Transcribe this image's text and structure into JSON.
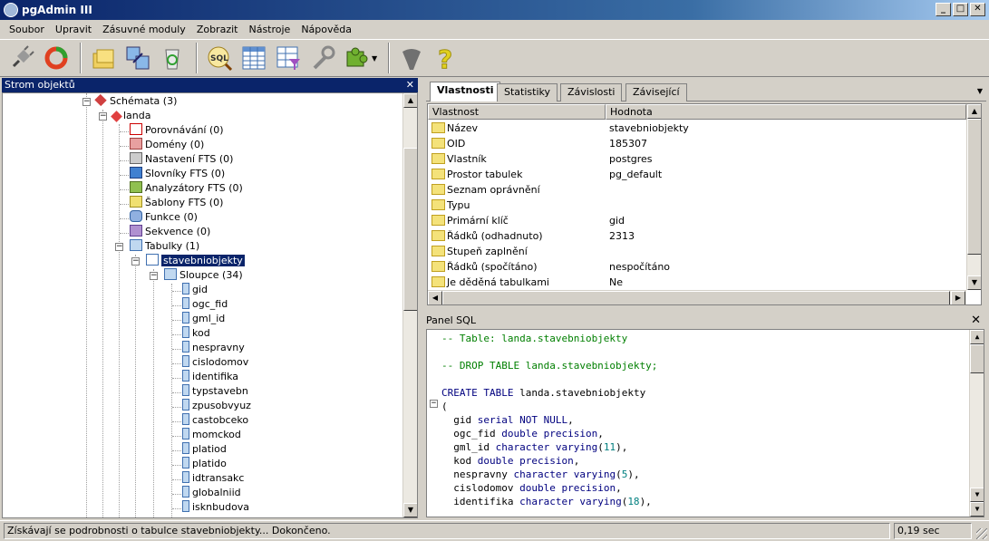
{
  "window": {
    "title": "pgAdmin III"
  },
  "menu": [
    "Soubor",
    "Upravit",
    "Zásuvné moduly",
    "Zobrazit",
    "Nástroje",
    "Nápověda"
  ],
  "toolbar": {
    "icons": [
      "plug-icon",
      "refresh-icon",
      "folders-icon",
      "transfer-icon",
      "recycle-icon",
      "sql-icon",
      "grid-icon",
      "filter-icon",
      "wrench-icon",
      "puzzle-icon",
      "elephant-icon",
      "help-icon"
    ]
  },
  "object_browser": {
    "title": "Strom objektů",
    "nodes": [
      "Schémata (3)",
      "landa",
      "Porovnávání (0)",
      "Domény (0)",
      "Nastavení FTS (0)",
      "Slovníky FTS (0)",
      "Analyzátory FTS (0)",
      "Šablony FTS (0)",
      "Funkce (0)",
      "Sekvence (0)",
      "Tabulky (1)",
      "stavebniobjekty",
      "Sloupce (34)"
    ],
    "columns": [
      "gid",
      "ogc_fid",
      "gml_id",
      "kod",
      "nespravny",
      "cislodomov",
      "identifika",
      "typstavebn",
      "zpusobvyuz",
      "castobceko",
      "momckod",
      "platiod",
      "platido",
      "idtransakc",
      "globalniid",
      "isknbudova"
    ]
  },
  "tabs": [
    "Vlastnosti",
    "Statistiky",
    "Závislosti",
    "Závisející"
  ],
  "properties": {
    "headers": [
      "Vlastnost",
      "Hodnota"
    ],
    "rows": [
      {
        "k": "Název",
        "v": "stavebniobjekty"
      },
      {
        "k": "OID",
        "v": "185307"
      },
      {
        "k": "Vlastník",
        "v": "postgres"
      },
      {
        "k": "Prostor tabulek",
        "v": "pg_default"
      },
      {
        "k": "Seznam oprávnění",
        "v": ""
      },
      {
        "k": "Typu",
        "v": ""
      },
      {
        "k": "Primární klíč",
        "v": "gid"
      },
      {
        "k": "Řádků (odhadnuto)",
        "v": "2313"
      },
      {
        "k": "Stupeň zaplnění",
        "v": ""
      },
      {
        "k": "Řádků (spočítáno)",
        "v": "nespočítáno"
      },
      {
        "k": "Je děděná tabulkami",
        "v": "Ne"
      }
    ]
  },
  "sql_panel": {
    "title": "Panel SQL",
    "lines": [
      {
        "t": "c",
        "s": "-- Table: landa.stavebniobjekty"
      },
      {
        "t": "p",
        "s": ""
      },
      {
        "t": "c",
        "s": "-- DROP TABLE landa.stavebniobjekty;"
      },
      {
        "t": "p",
        "s": ""
      },
      {
        "t": "p",
        "s": "CREATE TABLE landa.stavebniobjekty"
      },
      {
        "t": "p",
        "s": "("
      },
      {
        "t": "p",
        "s": "  gid serial NOT NULL,"
      },
      {
        "t": "p",
        "s": "  ogc_fid double precision,"
      },
      {
        "t": "p",
        "s": "  gml_id character varying(11),"
      },
      {
        "t": "p",
        "s": "  kod double precision,"
      },
      {
        "t": "p",
        "s": "  nespravny character varying(5),"
      },
      {
        "t": "p",
        "s": "  cislodomov double precision,"
      },
      {
        "t": "p",
        "s": "  identifika character varying(18),"
      }
    ]
  },
  "status": {
    "message": "Získávají se podrobnosti o tabulce stavebniobjekty... Dokončeno.",
    "time": "0,19 sec"
  },
  "colors": {
    "title_bar": "#0a246a",
    "selection": "#0a246a",
    "comment": "#007f00",
    "keyword": "#00007f"
  }
}
